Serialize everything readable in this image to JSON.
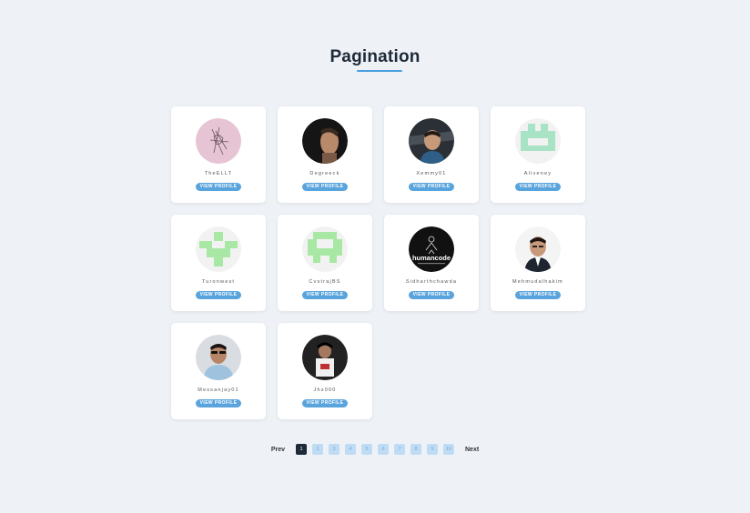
{
  "page": {
    "title": "Pagination"
  },
  "colors": {
    "accent": "#5aa4dd",
    "active_page": "#1e2a38",
    "page_bg": "#eef2f7"
  },
  "cards": [
    {
      "username": "TheELLT",
      "button": "VIEW PROFILE",
      "avatar": "sketch-photo"
    },
    {
      "username": "Degreeck",
      "button": "VIEW PROFILE",
      "avatar": "profile-photo"
    },
    {
      "username": "Xemmy01",
      "button": "VIEW PROFILE",
      "avatar": "photo"
    },
    {
      "username": "Aliveney",
      "button": "VIEW PROFILE",
      "avatar": "identicon"
    },
    {
      "username": "Turonwest",
      "button": "VIEW PROFILE",
      "avatar": "identicon"
    },
    {
      "username": "CvstrajBS",
      "button": "VIEW PROFILE",
      "avatar": "identicon"
    },
    {
      "username": "Sidharthchawda",
      "button": "VIEW PROFILE",
      "avatar": "humancode-logo",
      "logo_text": "humancode"
    },
    {
      "username": "Mehmudalhakim",
      "button": "VIEW PROFILE",
      "avatar": "photo"
    },
    {
      "username": "Messanjay01",
      "button": "VIEW PROFILE",
      "avatar": "photo"
    },
    {
      "username": "Jhs000",
      "button": "VIEW PROFILE",
      "avatar": "photo"
    }
  ],
  "pagination": {
    "prev": "Prev",
    "next": "Next",
    "pages": [
      "1",
      "2",
      "3",
      "4",
      "5",
      "6",
      "7",
      "8",
      "9",
      "10"
    ],
    "current": "1"
  }
}
